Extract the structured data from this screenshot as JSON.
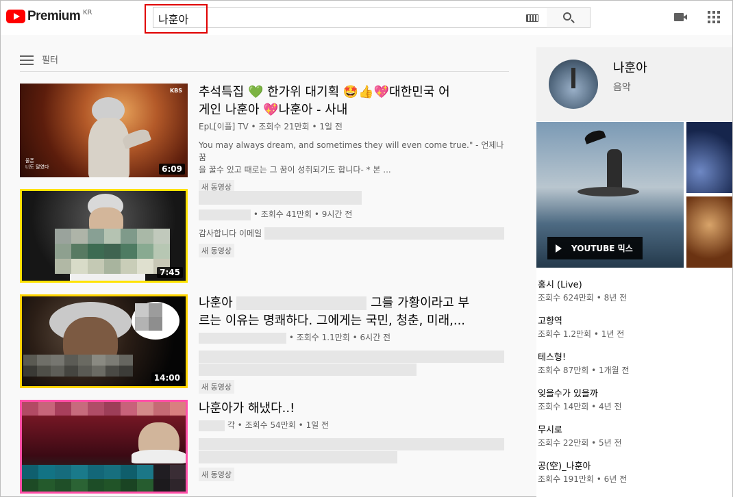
{
  "header": {
    "logo_text": "Premium",
    "logo_region": "KR",
    "search_value": "나훈아"
  },
  "filter": {
    "label": "필터"
  },
  "results": [
    {
      "title_line1": "추석특집 💚 한가위 대기획 🤩👍💖대한민국 어",
      "title_line2": "게인 나훈아 💖나훈아 - 사내",
      "meta": "EpL[이플] TV • 조회수 21만회 • 1일 전",
      "desc_line1": "You may always dream, and sometimes they will even come true.\" - 언제나 꿈",
      "desc_line2": "을 꿀수 있고 때로는 그 꿈이 성취되기도 합니다- * 본 ...",
      "badge": "새 동영상",
      "duration": "6:09",
      "thumb_caption": "울픈\n너도 말였다",
      "thumb_logo": "KBS"
    },
    {
      "meta": "• 조회수 41만회 • 9시간 전",
      "desc": "감사합니다 이메일",
      "badge": "새 동영상",
      "duration": "7:45"
    },
    {
      "title_line1_a": "나훈아",
      "title_line1_b": "그를 가황이라고 부",
      "title_line2": "르는 이유는 명쾌하다. 그에게는 국민, 청춘, 미래,...",
      "meta": "• 조회수 1.1만회 • 6시간 전",
      "badge": "새 동영상",
      "duration": "14:00"
    },
    {
      "title": "나훈아가 해냈다..!",
      "meta": "각 • 조회수 54만회 • 1일 전",
      "badge": "새 동영상"
    }
  ],
  "right_panel": {
    "channel_name": "나훈아",
    "channel_sub": "음악",
    "mix_label": "YOUTUBE 믹스",
    "songs": [
      {
        "title": "홍시 (Live)",
        "meta": "조회수 624만회 • 8년 전"
      },
      {
        "title": "고향역",
        "meta": "조회수 1.2만회 • 1년 전"
      },
      {
        "title": "테스형!",
        "meta": "조회수 87만회 • 1개월 전"
      },
      {
        "title": "잊을수가 있을까",
        "meta": "조회수 14만회 • 4년 전"
      },
      {
        "title": "무시로",
        "meta": "조회수 22만회 • 5년 전"
      },
      {
        "title": "공(空)_나훈아",
        "meta": "조회수 191만회 • 6년 전"
      }
    ]
  },
  "colors": {
    "brand_red": "#ff0000",
    "highlight_red": "#e00000",
    "thumb2_border": "#ffe200",
    "thumb4_border": "#ff4fa8"
  }
}
